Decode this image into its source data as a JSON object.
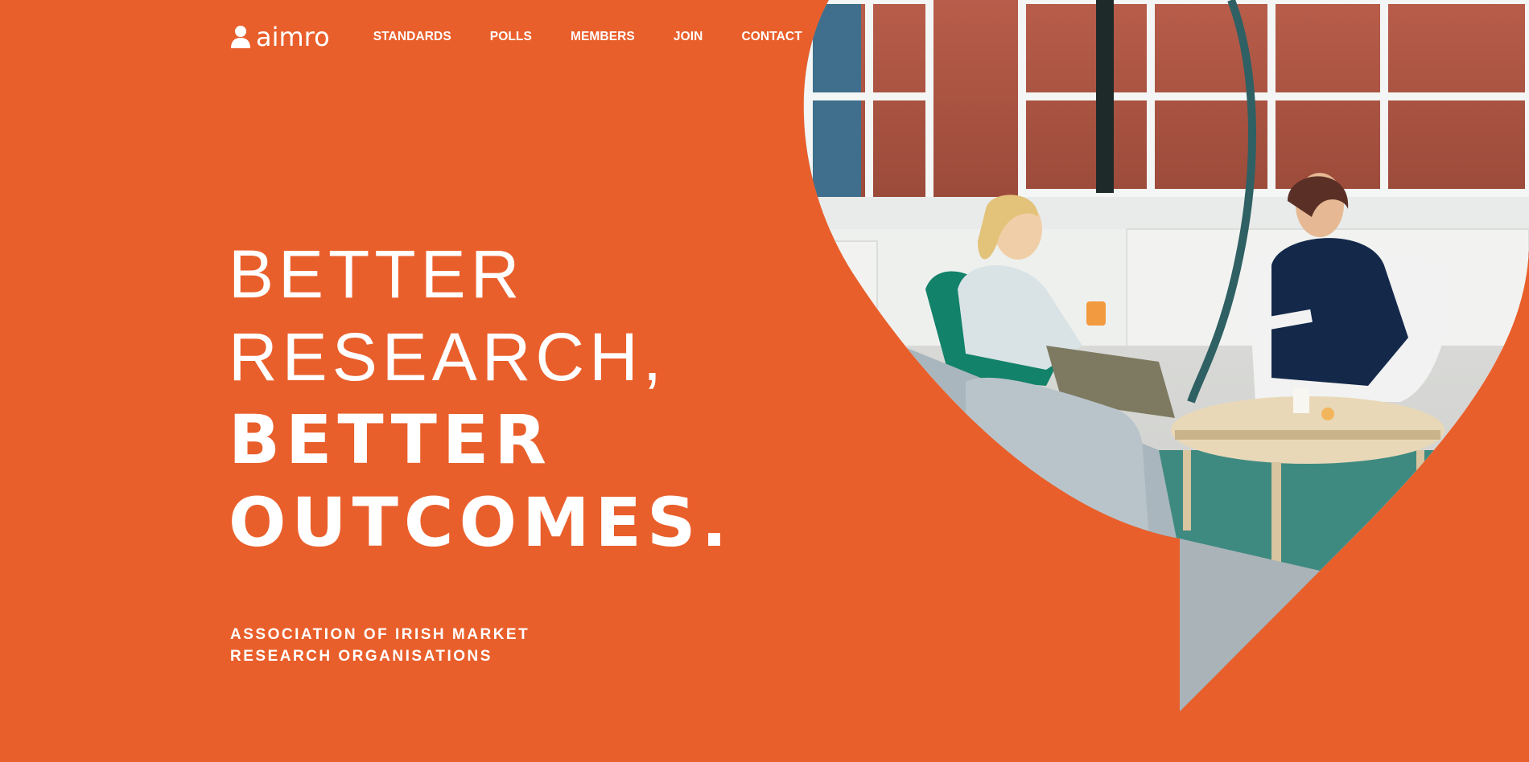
{
  "header": {
    "logo_text": "aimro",
    "logo_icon": "person-icon",
    "nav": [
      {
        "label": "STANDARDS"
      },
      {
        "label": "POLLS"
      },
      {
        "label": "MEMBERS"
      },
      {
        "label": "JOIN"
      },
      {
        "label": "CONTACT"
      }
    ]
  },
  "hero": {
    "line1": "BETTER",
    "line2": "RESEARCH,",
    "line3": "BETTER",
    "line4": "OUTCOMES.",
    "subtitle_line1": "ASSOCIATION OF IRISH MARKET",
    "subtitle_line2": "RESEARCH ORGANISATIONS"
  },
  "colors": {
    "brand_orange": "#e95f2b",
    "text": "#ffffff"
  }
}
